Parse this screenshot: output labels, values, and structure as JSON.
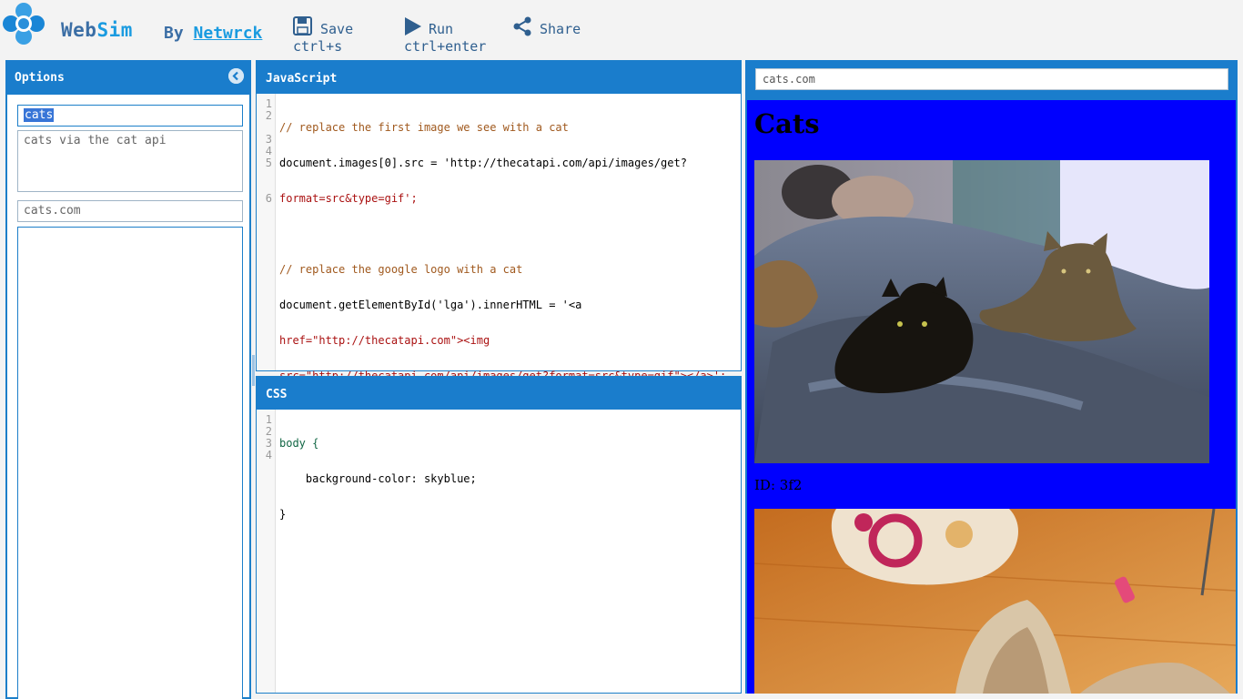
{
  "app": {
    "brand_part1": "Web",
    "brand_part2": "Sim",
    "by_label": "By",
    "author": "Netwrck"
  },
  "toolbar": {
    "save_label": "Save",
    "save_shortcut": "ctrl+s",
    "run_label": "Run",
    "run_shortcut": "ctrl+enter",
    "share_label": "Share"
  },
  "options": {
    "title": "Options",
    "name_value": "cats",
    "description_value": "cats via the cat api",
    "url_value": "cats.com",
    "big_field_value": ""
  },
  "editors": {
    "js_title": "JavaScript",
    "css_title": "CSS",
    "js_line_numbers": [
      "1",
      "2",
      "",
      "3",
      "4",
      "5",
      "",
      "",
      "6"
    ],
    "css_line_numbers": [
      "1",
      "2",
      "3",
      "4"
    ],
    "js_lines": [
      "// replace the first image we see with a cat",
      "document.images[0].src = 'http://thecatapi.com/api/images/get?",
      "format=src&type=gif';",
      "",
      "// replace the google logo with a cat",
      "document.getElementById('lga').innerHTML = '<a",
      "href=\"http://thecatapi.com\"><img",
      "src=\"http://thecatapi.com/api/images/get?format=src&type=gif\"></a>';",
      ""
    ],
    "css_lines": [
      "body {",
      "    background-color: skyblue;",
      "}",
      ""
    ]
  },
  "preview": {
    "url": "cats.com",
    "heading": "Cats",
    "image_id_text": "ID: 3f2",
    "background_color": "#0000fe"
  },
  "colors": {
    "accent": "#1a7dcc",
    "brand_dark": "#3b6ea5",
    "brand_light": "#1a9be0"
  }
}
